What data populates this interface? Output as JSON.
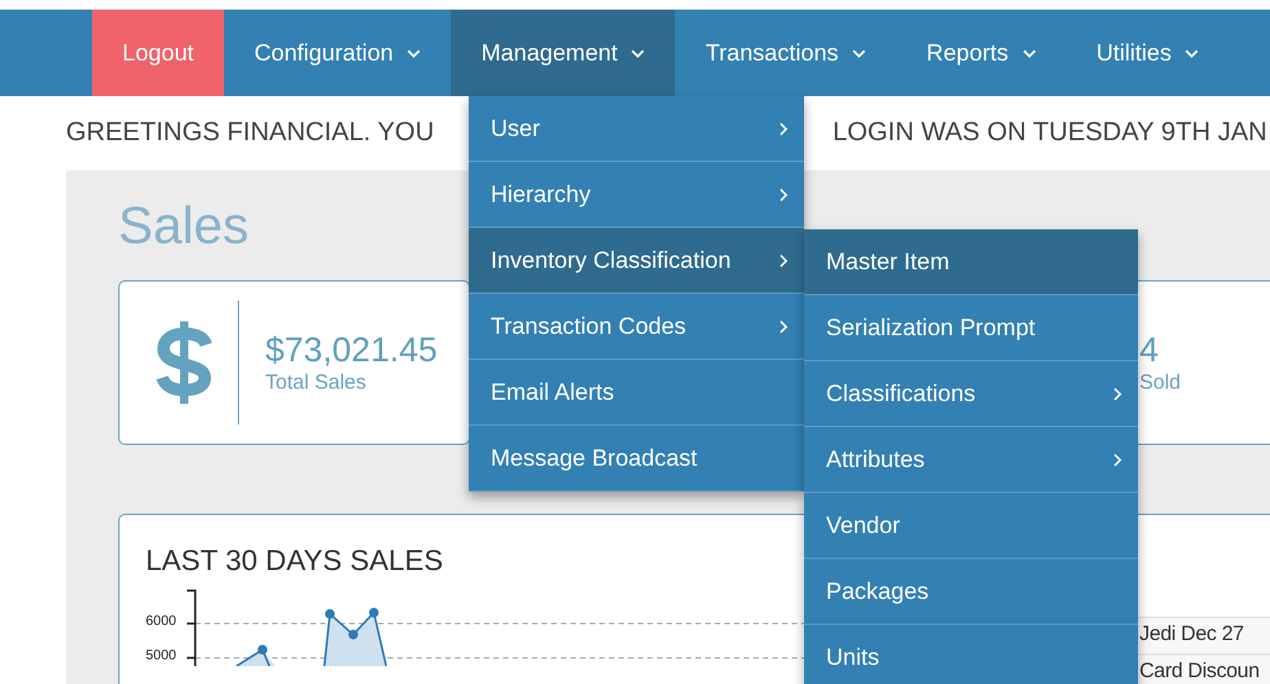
{
  "nav": [
    {
      "label": "Logout",
      "kind": "logout",
      "selected": false,
      "has_menu": false
    },
    {
      "label": "Configuration",
      "kind": "menu",
      "selected": false,
      "has_menu": true
    },
    {
      "label": "Management",
      "kind": "menu",
      "selected": true,
      "has_menu": true
    },
    {
      "label": "Transactions",
      "kind": "menu",
      "selected": false,
      "has_menu": true
    },
    {
      "label": "Reports",
      "kind": "menu",
      "selected": false,
      "has_menu": true
    },
    {
      "label": "Utilities",
      "kind": "menu",
      "selected": false,
      "has_menu": true
    }
  ],
  "greeting": [
    "GREETINGS FINANCIAL. YOU",
    "LOGIN WAS ON TUESDAY 9TH JAN"
  ],
  "page_title": "Sales",
  "stats": [
    {
      "value": "$73,021.45",
      "label": "Total Sales"
    },
    {
      "value": "4",
      "label": "Sold"
    }
  ],
  "chart_card": {
    "title": "LAST 30 DAYS SALES",
    "y_axis_labels": [
      "6000",
      "5000"
    ]
  },
  "recent_rows": [
    "Jedi Dec 27",
    "Card Discoun"
  ],
  "menu": [
    {
      "label": "User",
      "has_submenu": true,
      "selected": false
    },
    {
      "label": "Hierarchy",
      "has_submenu": true,
      "selected": false
    },
    {
      "label": "Inventory Classification",
      "has_submenu": true,
      "selected": true
    },
    {
      "label": "Transaction Codes",
      "has_submenu": true,
      "selected": false
    },
    {
      "label": "Email Alerts",
      "has_submenu": false,
      "selected": false
    },
    {
      "label": "Message Broadcast",
      "has_submenu": false,
      "selected": false
    }
  ],
  "submenu": [
    {
      "label": "Master Item",
      "has_submenu": false,
      "selected": true
    },
    {
      "label": "Serialization Prompt",
      "has_submenu": false,
      "selected": false
    },
    {
      "label": "Classifications",
      "has_submenu": true,
      "selected": false
    },
    {
      "label": "Attributes",
      "has_submenu": true,
      "selected": false
    },
    {
      "label": "Vendor",
      "has_submenu": false,
      "selected": false
    },
    {
      "label": "Packages",
      "has_submenu": false,
      "selected": false
    },
    {
      "label": "Units",
      "has_submenu": false,
      "selected": false
    }
  ]
}
